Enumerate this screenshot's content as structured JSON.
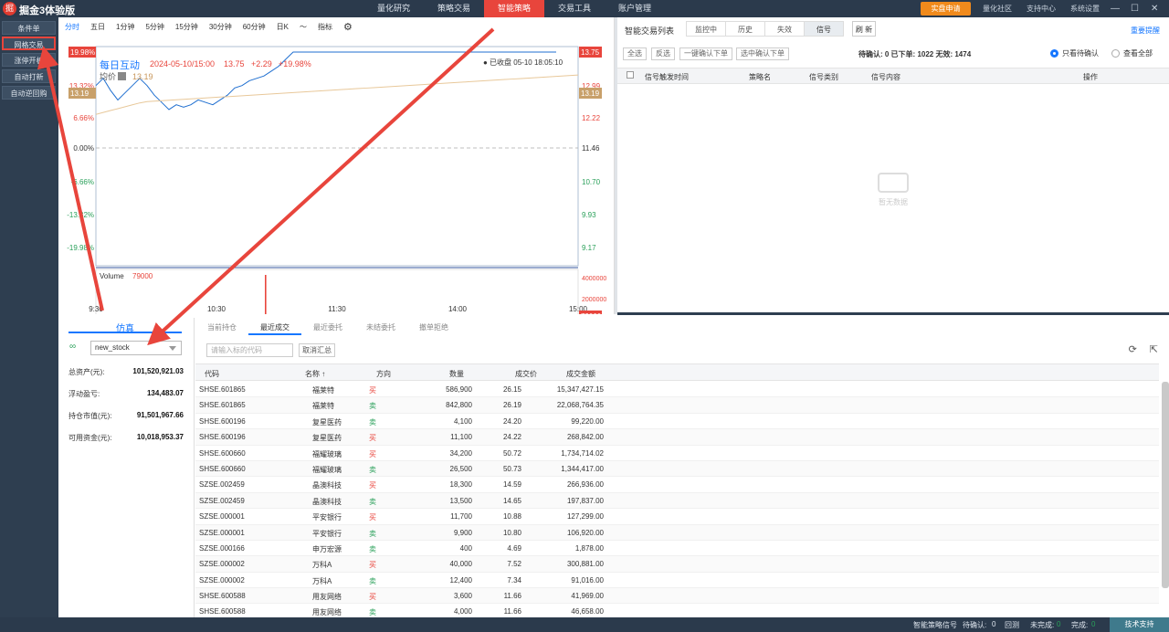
{
  "app": {
    "title": "掘金3体验版",
    "logo_text": "掘"
  },
  "topnav": [
    "量化研究",
    "策略交易",
    "智能策略",
    "交易工具",
    "账户管理"
  ],
  "topnav_active": 2,
  "real_btn": "实盘申请",
  "toplinks": [
    "量化社区",
    "支持中心",
    "系统设置"
  ],
  "window": {
    "min": "—",
    "max": "☐",
    "close": "✕"
  },
  "leftbar": [
    "条件单",
    "网格交易",
    "涨停开板",
    "自动打新",
    "自动逆回购"
  ],
  "leftbar_selected": 1,
  "chart": {
    "periods": [
      "分时",
      "五日",
      "1分钟",
      "5分钟",
      "15分钟",
      "30分钟",
      "60分钟",
      "日K",
      "〜",
      "指标",
      "⚙"
    ],
    "stock_name": "每日互动",
    "datetime": "2024-05-10/15:00",
    "price": "13.75",
    "change": "+2.29",
    "change_pct": "+19.98%",
    "avg_label": "均价",
    "avg_value": "13.19",
    "closed_note": "● 已收盘 05-10 18:05:10",
    "left_ticks": [
      "19.98%",
      "13.32%",
      "6.66%",
      "0.00%",
      "-6.66%",
      "-13.32%",
      "-19.98%"
    ],
    "right_ticks": [
      "13.75",
      "12.99",
      "12.22",
      "11.46",
      "10.70",
      "9.93",
      "9.17"
    ],
    "left_tag": "13.19",
    "right_tag": "13.19",
    "volume_label": "Volume",
    "volume_value": "79000",
    "vol_ticks": [
      "4000000",
      "2000000"
    ],
    "vol_tag": "79000",
    "time_ticks": [
      "9:30",
      "10:30",
      "11:30",
      "14:00",
      "15:00"
    ]
  },
  "chart_data": {
    "type": "line",
    "x": [
      "09:30",
      "10:30",
      "11:30/13:00",
      "14:00",
      "15:00"
    ],
    "series": [
      {
        "name": "每日互动",
        "values_pct": [
          13.0,
          11.0,
          19.98,
          19.98,
          19.98
        ]
      },
      {
        "name": "均价",
        "values_pct": [
          9.0,
          10.5,
          13.0,
          14.0,
          15.0
        ]
      }
    ],
    "ylim_pct": [
      -19.98,
      19.98
    ],
    "price_ylim": [
      9.17,
      13.75
    ],
    "volume_ylim": [
      0,
      4000000
    ]
  },
  "signals": {
    "title": "智能交易列表",
    "tabs": [
      "监控中",
      "历史",
      "失效",
      "信号"
    ],
    "active_tab": 3,
    "refresh": "刷 新",
    "important": "重要提醒",
    "buttons": [
      "全选",
      "反选",
      "一键确认下单",
      "选中确认下单"
    ],
    "stats": "待确认: 0   已下单: 1022   无效: 1474",
    "radio1": "只看待确认",
    "radio2": "查看全部",
    "headers": [
      "信号触发时间",
      "策略名",
      "信号类别",
      "信号内容",
      "操作"
    ],
    "empty": "暂无数据"
  },
  "account": {
    "tab": "仿真",
    "select": "new_stock",
    "rows": [
      {
        "k": "总资产(元):",
        "v": "101,520,921.03"
      },
      {
        "k": "浮动盈亏:",
        "v": "134,483.07"
      },
      {
        "k": "持仓市值(元):",
        "v": "91,501,967.66"
      },
      {
        "k": "可用资金(元):",
        "v": "10,018,953.37"
      }
    ]
  },
  "trades": {
    "tabs": [
      "当前持仓",
      "最近成交",
      "最近委托",
      "未结委托",
      "撤单拒绝"
    ],
    "active_tab": 1,
    "search_placeholder": "请输入标的代码",
    "cancel": "取消汇总",
    "headers": [
      "代码",
      "名称 ↑",
      "方向",
      "数量",
      "成交价",
      "成交金额"
    ],
    "rows": [
      [
        "SHSE.601865",
        "福莱特",
        "买",
        "586,900",
        "26.15",
        "15,347,427.15"
      ],
      [
        "SHSE.601865",
        "福莱特",
        "卖",
        "842,800",
        "26.19",
        "22,068,764.35"
      ],
      [
        "SHSE.600196",
        "复星医药",
        "卖",
        "4,100",
        "24.20",
        "99,220.00"
      ],
      [
        "SHSE.600196",
        "复星医药",
        "买",
        "11,100",
        "24.22",
        "268,842.00"
      ],
      [
        "SHSE.600660",
        "福耀玻璃",
        "买",
        "34,200",
        "50.72",
        "1,734,714.02"
      ],
      [
        "SHSE.600660",
        "福耀玻璃",
        "卖",
        "26,500",
        "50.73",
        "1,344,417.00"
      ],
      [
        "SZSE.002459",
        "晶澳科技",
        "买",
        "18,300",
        "14.59",
        "266,936.00"
      ],
      [
        "SZSE.002459",
        "晶澳科技",
        "卖",
        "13,500",
        "14.65",
        "197,837.00"
      ],
      [
        "SZSE.000001",
        "平安银行",
        "买",
        "11,700",
        "10.88",
        "127,299.00"
      ],
      [
        "SZSE.000001",
        "平安银行",
        "卖",
        "9,900",
        "10.80",
        "106,920.00"
      ],
      [
        "SZSE.000166",
        "申万宏源",
        "卖",
        "400",
        "4.69",
        "1,878.00"
      ],
      [
        "SZSE.000002",
        "万科A",
        "买",
        "40,000",
        "7.52",
        "300,881.00"
      ],
      [
        "SZSE.000002",
        "万科A",
        "卖",
        "12,400",
        "7.34",
        "91,016.00"
      ],
      [
        "SHSE.600588",
        "用友网络",
        "买",
        "3,600",
        "11.66",
        "41,969.00"
      ],
      [
        "SHSE.600588",
        "用友网络",
        "卖",
        "4,000",
        "11.66",
        "46,658.00"
      ]
    ]
  },
  "status": {
    "sig": "智能策略信号",
    "pending": "待确认:",
    "pending_val": "0",
    "backtest": "回测",
    "undone": "未完成:",
    "undone_val": "0",
    "done": "完成:",
    "done_val": "0",
    "tech": "技术支持"
  },
  "colors": {
    "accent": "#e8453c",
    "blue": "#1677ff",
    "buy": "#e8453c",
    "sell": "#2aa05a",
    "dark": "#2b3a4c"
  }
}
